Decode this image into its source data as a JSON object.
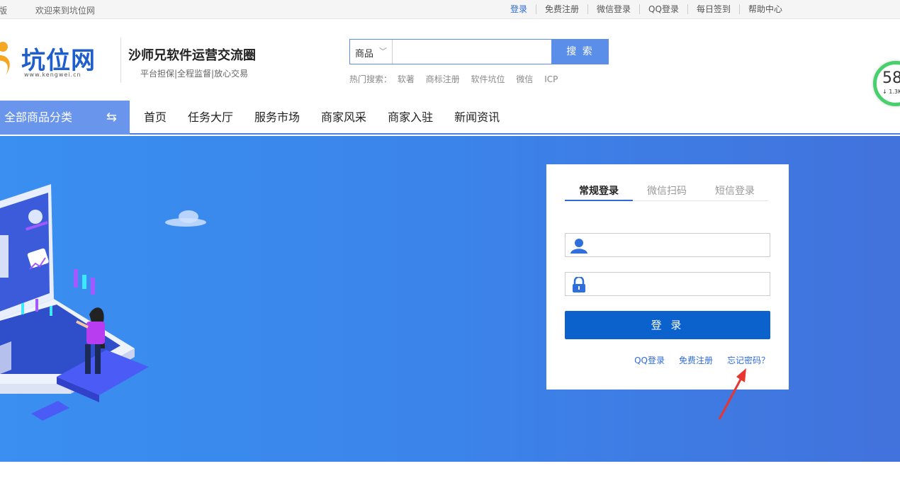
{
  "topbar": {
    "edition": "版",
    "welcome": "欢迎来到坑位网",
    "links": [
      "登录",
      "免费注册",
      "微信登录",
      "QQ登录",
      "每日签到",
      "帮助中心"
    ]
  },
  "header": {
    "logo_text": "坑位网",
    "logo_domain": "www.kengwei.cn",
    "slogan": "沙师兄软件运营交流圈",
    "subslogan": "平台担保|全程监督|放心交易"
  },
  "search": {
    "category": "商品",
    "input_value": "",
    "button": "搜 索",
    "hot_label": "热门搜索：",
    "hot_terms": [
      "软著",
      "商标注册",
      "软件坑位",
      "微信",
      "ICP"
    ]
  },
  "meter": {
    "value": "58",
    "sub": "1.3K"
  },
  "nav": {
    "category_label": "全部商品分类",
    "items": [
      "首页",
      "任务大厅",
      "服务市场",
      "商家风采",
      "商家入驻",
      "新闻资讯"
    ]
  },
  "login": {
    "tabs": [
      "常规登录",
      "微信扫码",
      "短信登录"
    ],
    "active_tab": 0,
    "username_value": "",
    "password_value": "",
    "submit": "登 录",
    "links": [
      "QQ登录",
      "免费注册",
      "忘记密码？"
    ]
  },
  "colors": {
    "brand_blue": "#2e6bd8",
    "login_button": "#0b62cc",
    "banner_start": "#3a8ff0",
    "banner_end": "#4272dc",
    "annotation_arrow": "#e8352f"
  }
}
